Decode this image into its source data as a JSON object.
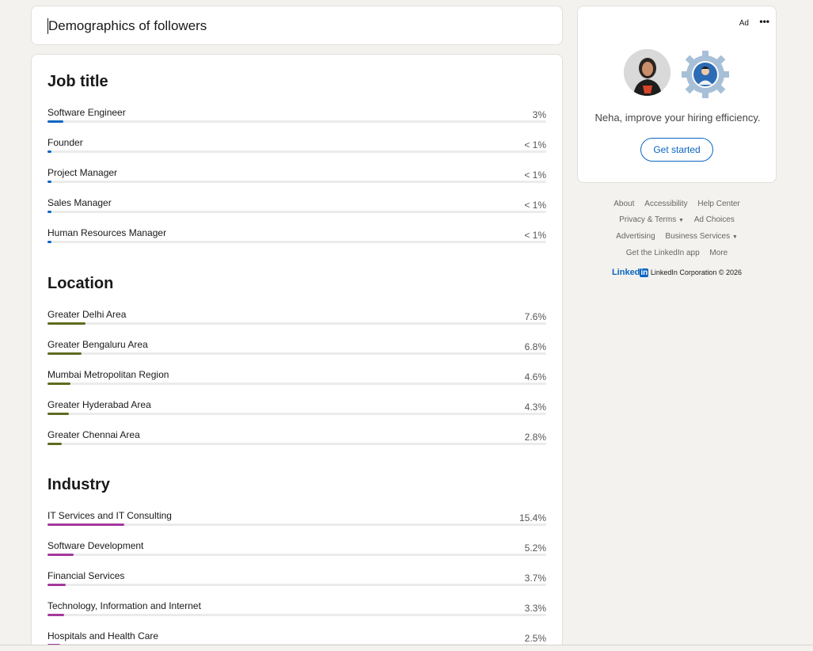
{
  "header": {
    "title": "Demographics of followers"
  },
  "job_title": {
    "heading": "Job title",
    "accent": "#0a66c2",
    "items": [
      {
        "label": "Software Engineer",
        "value": "3%",
        "fraction": 0.031
      },
      {
        "label": "Founder",
        "value": "< 1%",
        "fraction": 0.008
      },
      {
        "label": "Project Manager",
        "value": "< 1%",
        "fraction": 0.008
      },
      {
        "label": "Sales Manager",
        "value": "< 1%",
        "fraction": 0.008
      },
      {
        "label": "Human Resources Manager",
        "value": "< 1%",
        "fraction": 0.008
      }
    ]
  },
  "location": {
    "heading": "Location",
    "accent": "#5f6b1f",
    "items": [
      {
        "label": "Greater Delhi Area",
        "value": "7.6%",
        "fraction": 0.076
      },
      {
        "label": "Greater Bengaluru Area",
        "value": "6.8%",
        "fraction": 0.068
      },
      {
        "label": "Mumbai Metropolitan Region",
        "value": "4.6%",
        "fraction": 0.046
      },
      {
        "label": "Greater Hyderabad Area",
        "value": "4.3%",
        "fraction": 0.043
      },
      {
        "label": "Greater Chennai Area",
        "value": "2.8%",
        "fraction": 0.028
      }
    ]
  },
  "industry": {
    "heading": "Industry",
    "accent": "#a4399d",
    "items": [
      {
        "label": "IT Services and IT Consulting",
        "value": "15.4%",
        "fraction": 0.154
      },
      {
        "label": "Software Development",
        "value": "5.2%",
        "fraction": 0.052
      },
      {
        "label": "Financial Services",
        "value": "3.7%",
        "fraction": 0.037
      },
      {
        "label": "Technology, Information and Internet",
        "value": "3.3%",
        "fraction": 0.033
      },
      {
        "label": "Hospitals and Health Care",
        "value": "2.5%",
        "fraction": 0.025
      }
    ]
  },
  "ad": {
    "label": "Ad",
    "more_icon": "more-horizontal-icon",
    "message": "Neha, improve your hiring efficiency.",
    "cta": "Get started"
  },
  "footer": {
    "links_row1": [
      "About",
      "Accessibility",
      "Help Center"
    ],
    "privacy": "Privacy & Terms",
    "ad_choices": "Ad Choices",
    "advertising": "Advertising",
    "business": "Business Services",
    "app": "Get the LinkedIn app",
    "more": "More",
    "logo_text": "Linked",
    "logo_in": "in",
    "copyright": "LinkedIn Corporation © 2026"
  }
}
